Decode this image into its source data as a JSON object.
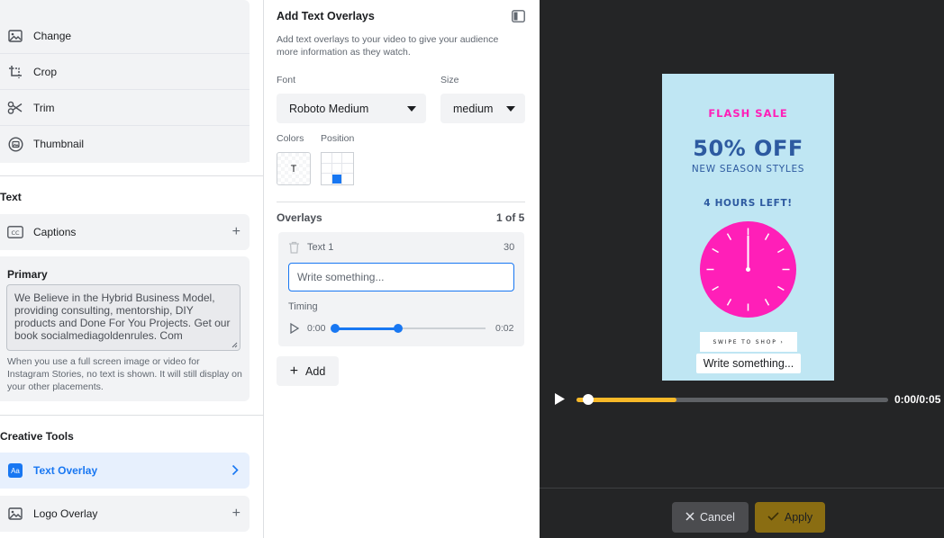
{
  "left": {
    "tools": [
      {
        "label": "Change",
        "icon": "image-icon"
      },
      {
        "label": "Crop",
        "icon": "crop-icon"
      },
      {
        "label": "Trim",
        "icon": "scissors-icon"
      },
      {
        "label": "Thumbnail",
        "icon": "thumbnail-icon"
      }
    ],
    "text_section_title": "Text",
    "captions_label": "Captions",
    "primary_title": "Primary",
    "primary_text": "We Believe in the Hybrid Business Model, providing consulting, mentorship, DIY products and Done For You Projects. Get our book socialmediagoldenrules. Com",
    "primary_help": "When you use a full screen image or video for Instagram Stories, no text is shown. It will still display on your other placements.",
    "creative_tools_title": "Creative Tools",
    "text_overlay_label": "Text Overlay",
    "text_overlay_badge": "Aa",
    "logo_overlay_label": "Logo Overlay"
  },
  "mid": {
    "title": "Add Text Overlays",
    "description": "Add text overlays to your video to give your audience more information as they watch.",
    "font_label": "Font",
    "font_value": "Roboto Medium",
    "size_label": "Size",
    "size_value": "medium",
    "colors_label": "Colors",
    "color_swatch_text": "T",
    "position_label": "Position",
    "position_selected_cell": 7,
    "overlays_label": "Overlays",
    "overlays_count": "1 of 5",
    "overlay_item_label": "Text 1",
    "overlay_char_count": "30",
    "input_placeholder": "Write something...",
    "timing_label": "Timing",
    "timing_start": "0:00",
    "timing_end": "0:02",
    "timing_fraction_start": 0.0,
    "timing_fraction_end": 0.42,
    "add_label": "Add"
  },
  "preview": {
    "flash_sale": "FLASH SALE",
    "discount": "50% OFF",
    "subtitle": "NEW SEASON STYLES",
    "hours_left": "4 HOURS LEFT!",
    "swipe_text": "SWIPE TO SHOP ›",
    "overlay_text": "Write something...",
    "time_display": "0:00/0:05",
    "progress_fraction": 0.32,
    "knob_fraction": 0.03,
    "cancel_label": "Cancel",
    "apply_label": "Apply"
  },
  "colors": {
    "accent_blue": "#1877f2",
    "preview_bg": "#bfe6f3",
    "magenta": "#ff1fb8",
    "navy": "#2d5aa0",
    "progress_yellow": "#f7b928",
    "apply_bg": "#8a6d12"
  }
}
